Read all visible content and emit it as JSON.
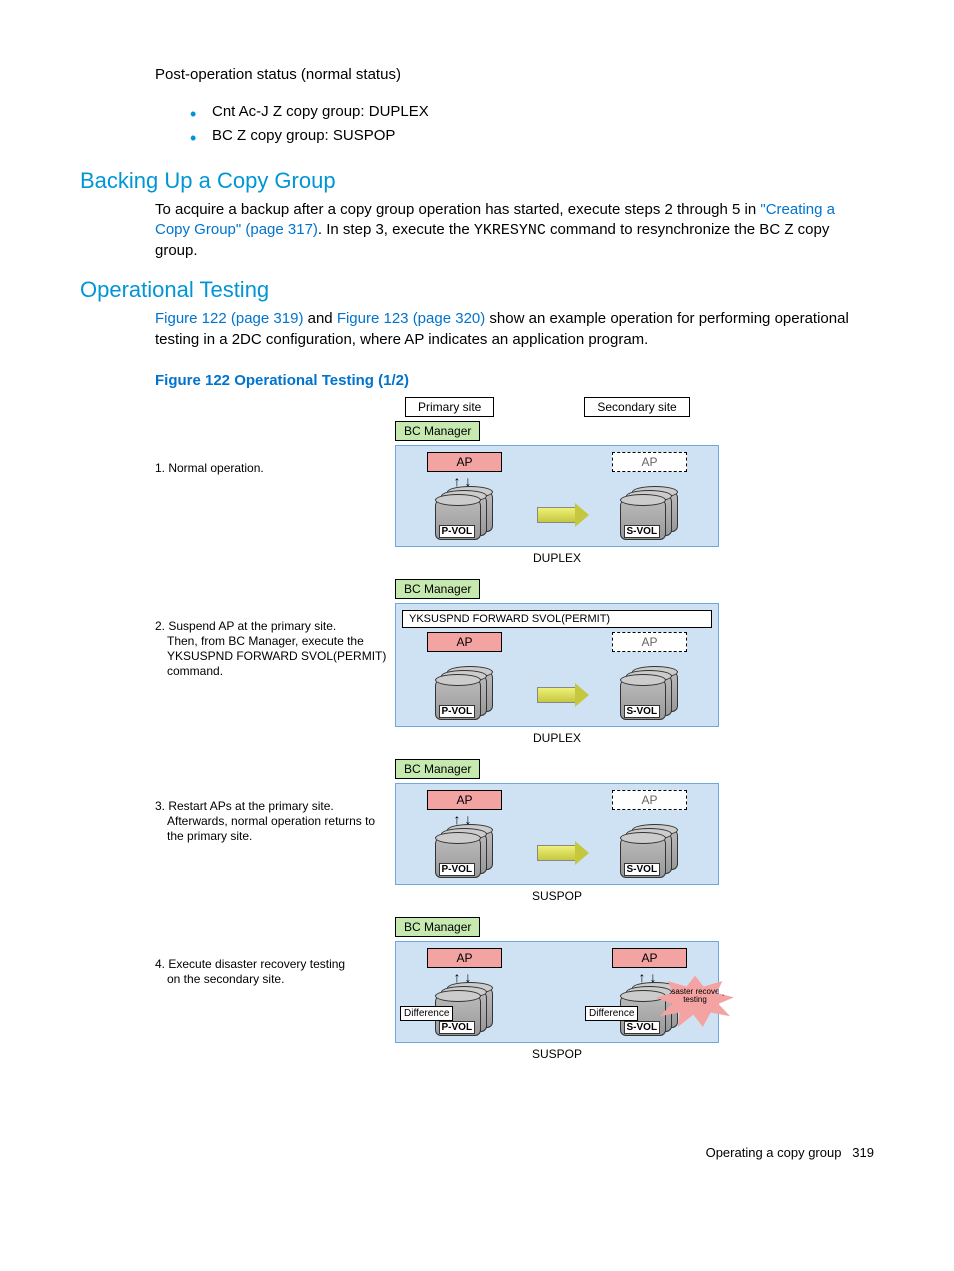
{
  "intro": {
    "status_line": "Post-operation status (normal status)",
    "bullets": [
      "Cnt Ac-J Z copy group: DUPLEX",
      "BC Z copy group: SUSPOP"
    ]
  },
  "section_backing": {
    "heading": "Backing Up a Copy Group",
    "para_before_link": "To acquire a backup after a copy group operation has started, execute steps 2 through 5 in ",
    "link_text": "\"Creating a Copy Group\" (page 317)",
    "para_mid1": ". In step 3, execute the ",
    "command": "YKRESYNC",
    "para_after": " command to resynchronize the BC Z copy group."
  },
  "section_optest": {
    "heading": "Operational Testing",
    "link1": "Figure 122 (page 319)",
    "mid": " and ",
    "link2": "Figure 123 (page 320)",
    "rest": " show an example operation for performing operational testing in a 2DC configuration, where AP indicates an application program."
  },
  "figure": {
    "caption": "Figure 122 Operational Testing (1/2)",
    "primary_site": "Primary site",
    "secondary_site": "Secondary site",
    "bc_manager": "BC Manager",
    "ap": "AP",
    "pvol": "P-VOL",
    "svol": "S-VOL",
    "duplex": "DUPLEX",
    "suspop": "SUSPOP",
    "difference": "Difference",
    "command_bar": "YKSUSPND FORWARD SVOL(PERMIT)",
    "burst_label": "Disaster recovery testing",
    "steps": {
      "s1": "1. Normal operation.",
      "s2_main": "2. Suspend AP at the primary site.",
      "s2_sub": "Then, from BC Manager, execute the YKSUSPND FORWARD SVOL(PERMIT) command.",
      "s3_main": "3. Restart APs at the primary site.",
      "s3_sub": "Afterwards, normal operation returns to the primary site.",
      "s4_main": "4. Execute disaster recovery testing",
      "s4_sub": "on the secondary site."
    }
  },
  "footer": {
    "text": "Operating a copy group",
    "page": "319"
  }
}
